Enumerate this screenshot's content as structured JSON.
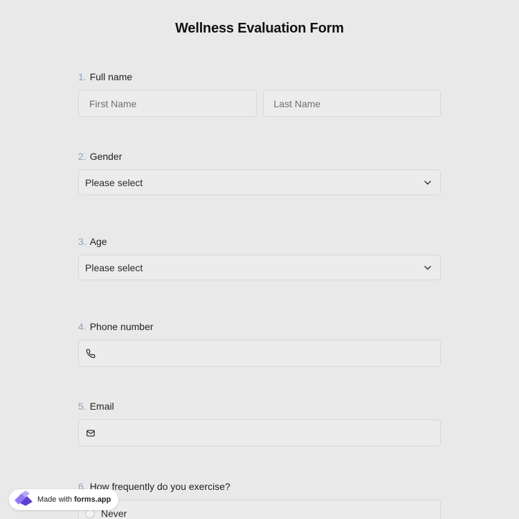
{
  "form": {
    "title": "Wellness Evaluation Form"
  },
  "questions": {
    "q1": {
      "number": "1.",
      "label": "Full name",
      "first_placeholder": "First Name",
      "last_placeholder": "Last Name"
    },
    "q2": {
      "number": "2.",
      "label": "Gender",
      "selected": "Please select"
    },
    "q3": {
      "number": "3.",
      "label": "Age",
      "selected": "Please select"
    },
    "q4": {
      "number": "4.",
      "label": "Phone number",
      "icon": "phone-icon"
    },
    "q5": {
      "number": "5.",
      "label": "Email",
      "icon": "mail-icon"
    },
    "q6": {
      "number": "6.",
      "label": "How frequently do you exercise?",
      "options": [
        "Never"
      ]
    }
  },
  "badge": {
    "prefix": "Made with",
    "brand": "forms.app"
  },
  "colors": {
    "background": "#e9e9e9",
    "field_bg": "#ececec",
    "question_number": "#8aa2c2",
    "brand_purple": "#6b4de6"
  }
}
